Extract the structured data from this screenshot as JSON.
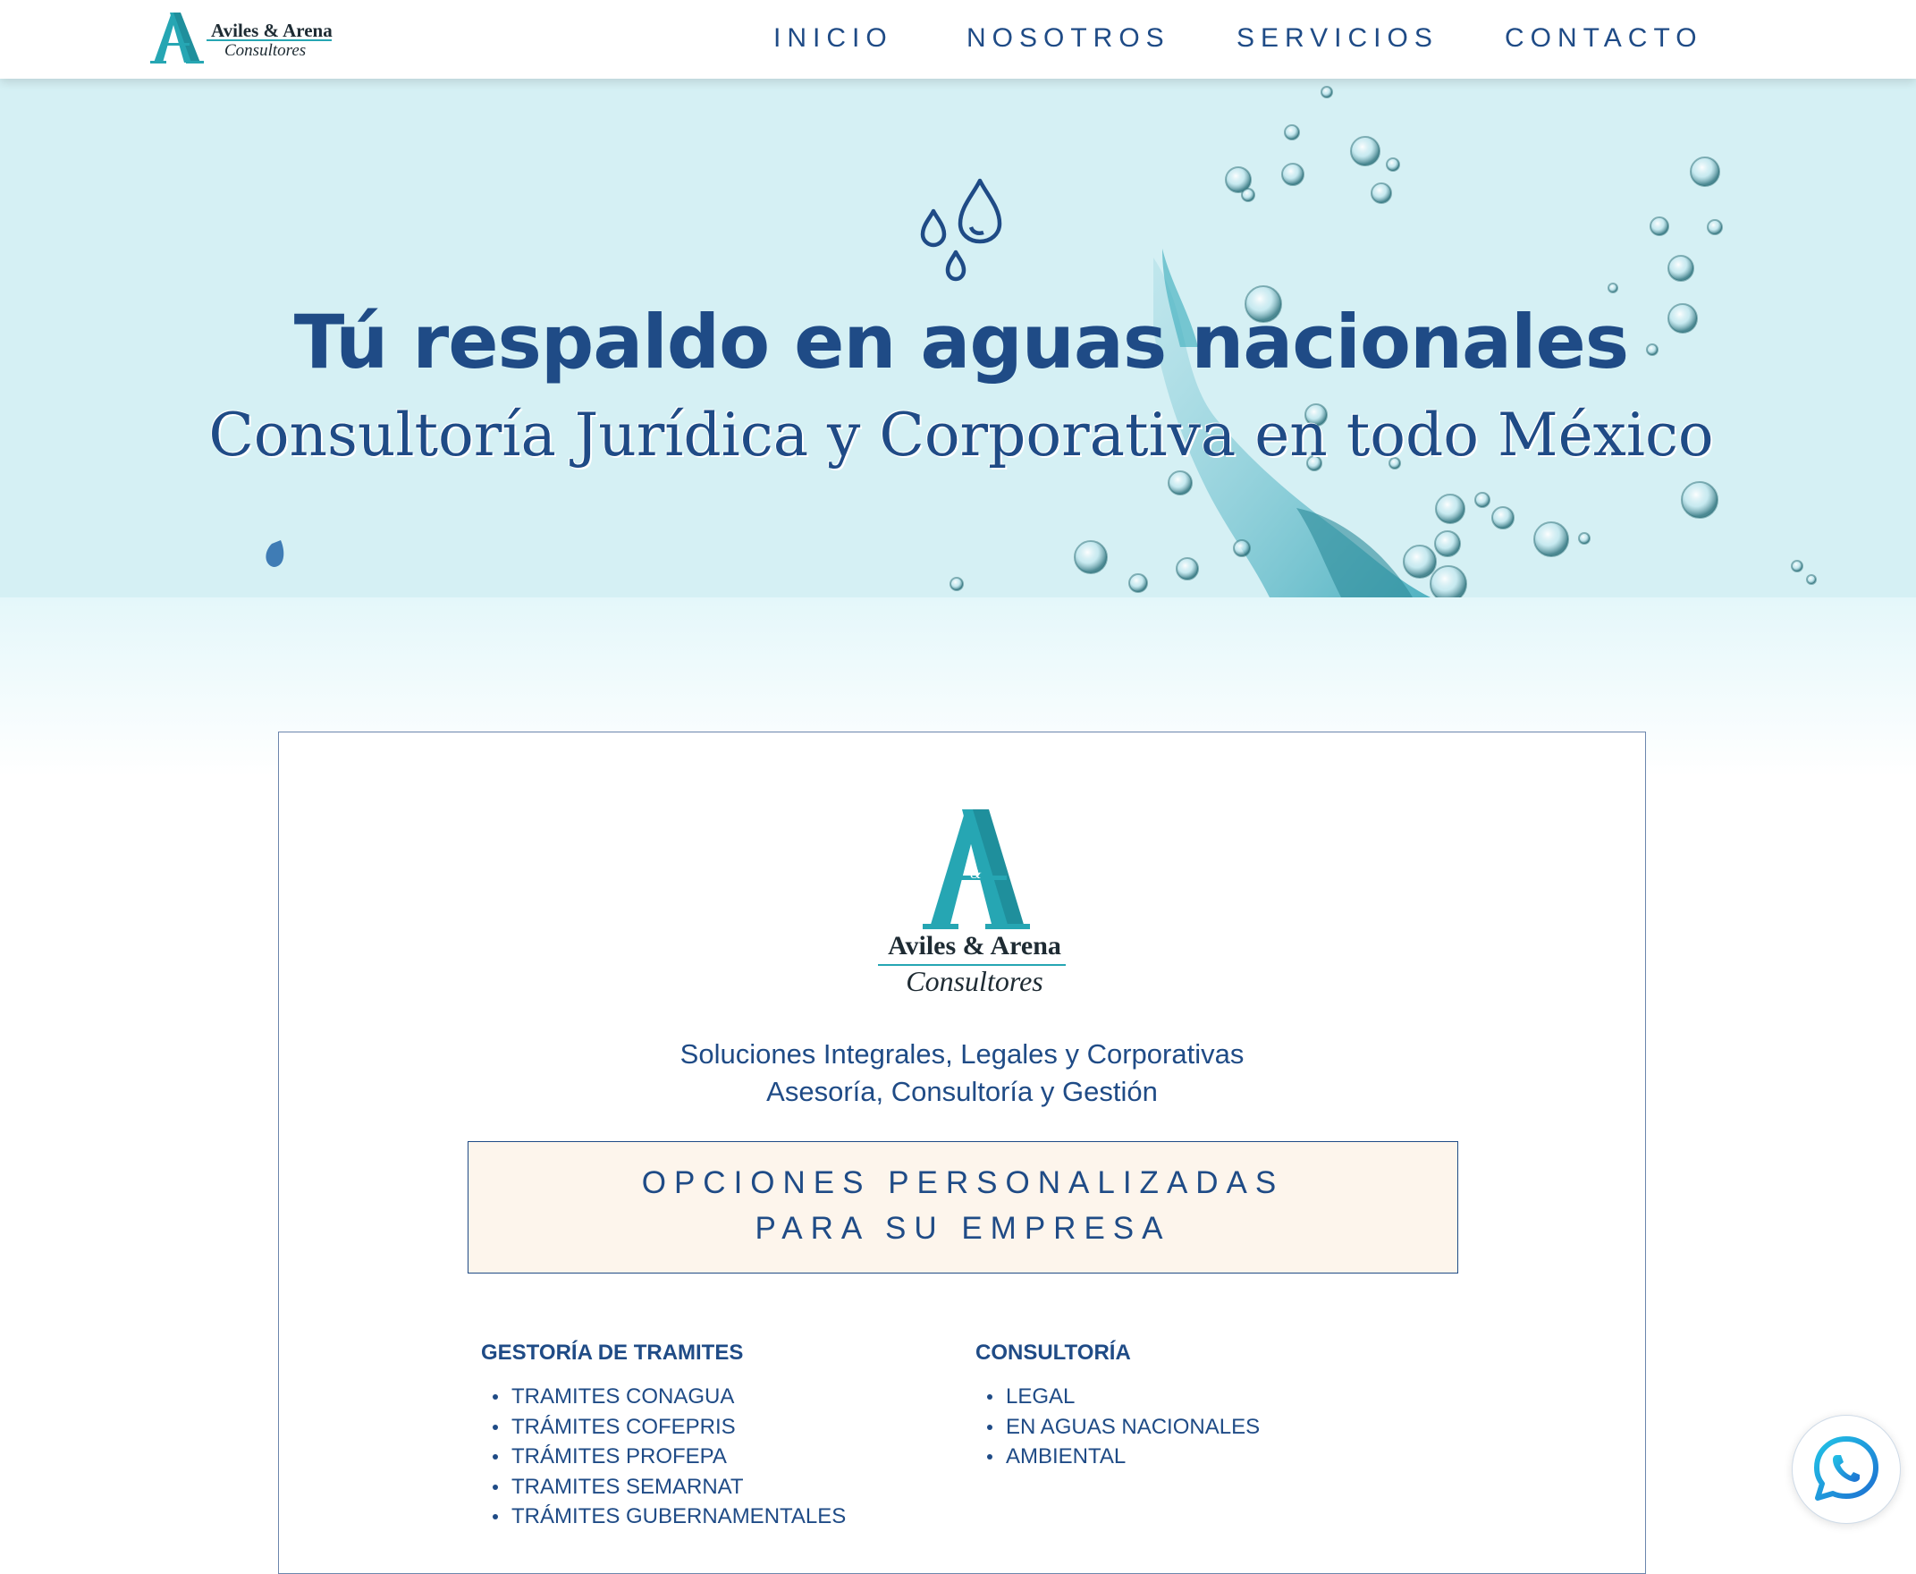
{
  "brand": {
    "name": "Aviles & Arena",
    "subtitle": "Consultores"
  },
  "nav": {
    "items": [
      "INICIO",
      "NOSOTROS",
      "SERVICIOS",
      "CONTACTO"
    ]
  },
  "hero": {
    "title": "Tú respaldo en aguas nacionales",
    "subtitle": "Consultoría Jurídica y Corporativa en todo México"
  },
  "card": {
    "tagline_1": "Soluciones Integrales, Legales y Corporativas",
    "tagline_2": "Asesoría, Consultoría y Gestión",
    "options_line_1": "OPCIONES PERSONALIZADAS",
    "options_line_2": "PARA SU EMPRESA",
    "columns": [
      {
        "title": "GESTORÍA DE TRAMITES",
        "items": [
          "TRAMITES CONAGUA",
          "TRÁMITES COFEPRIS",
          "TRÁMITES PROFEPA",
          "TRAMITES SEMARNAT",
          "TRÁMITES GUBERNAMENTALES"
        ]
      },
      {
        "title": "CONSULTORÍA",
        "items": [
          "LEGAL",
          "EN AGUAS NACIONALES",
          "AMBIENTAL"
        ]
      }
    ]
  },
  "icons": {
    "hero": "water-drops-icon",
    "floating": "whatsapp-icon"
  },
  "colors": {
    "primary": "#1f4b86",
    "accent": "#26a6b3",
    "hero_bg": "#d5f0f4",
    "options_bg": "#fdf5ec"
  }
}
